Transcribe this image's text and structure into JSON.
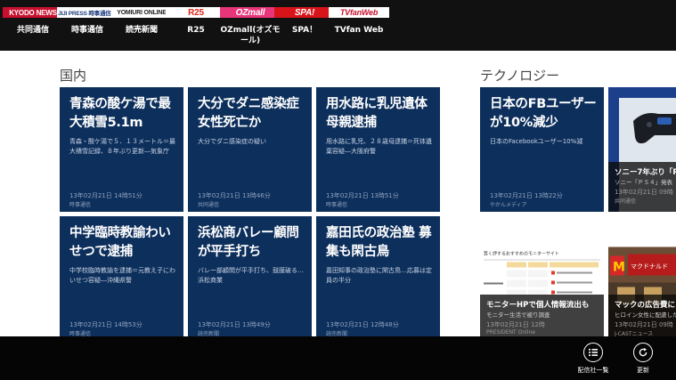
{
  "publishers": [
    {
      "logo": "KYODO NEWS",
      "name": "共同通信",
      "logo_bg": "#c8102e",
      "logo_fg": "#ffffff"
    },
    {
      "logo": "JIJI PRESS 時事通信社",
      "name": "時事通信",
      "logo_bg": "#ffffff",
      "logo_fg": "#1a3a7a"
    },
    {
      "logo": "YOMIURI ONLINE",
      "name": "読売新聞",
      "logo_bg": "#ffffff",
      "logo_fg": "#222222"
    },
    {
      "logo": "R25",
      "name": "R25",
      "logo_bg": "#ffffff",
      "logo_fg": "#e2231a"
    },
    {
      "logo": "OZmall",
      "name": "OZmall(オズモール)",
      "logo_bg": "#e8357a",
      "logo_fg": "#ffffff"
    },
    {
      "logo": "SPA!",
      "name": "SPA！",
      "logo_bg": "#d7141a",
      "logo_fg": "#ffffff"
    },
    {
      "logo": "TVfanWeb",
      "name": "TVfan Web",
      "logo_bg": "#ffffff",
      "logo_fg": "#c8102e"
    }
  ],
  "sections": {
    "domestic": {
      "title": "国内",
      "tiles": [
        {
          "headline": "青森の酸ケ湯で最大積雪5.1m",
          "summary": "青森・酸ケ湯で５．１３メートル＝最大積雪記録、８年ぶり更新―気象庁",
          "date": "13年02月21日 14時51分",
          "source": "時事通信"
        },
        {
          "headline": "大分でダニ感染症女性死亡か",
          "summary": "大分でダニ感染症の疑い",
          "date": "13年02月21日 13時46分",
          "source": "共同通信"
        },
        {
          "headline": "用水路に乳児遺体 母親逮捕",
          "summary": "用水路に乳児、２８歳母逮捕＝死体遺棄容疑―大阪府警",
          "date": "13年02月21日 13時51分",
          "source": "時事通信"
        },
        {
          "headline": "中学臨時教諭わいせつで逮捕",
          "summary": "中学校臨時教諭を逮捕＝元教え子にわいせつ容疑―沖縄県警",
          "date": "13年02月21日 14時53分",
          "source": "時事通信"
        },
        {
          "headline": "浜松商バレー顧問が平手打ち",
          "summary": "バレー部顧問が平手打ち、鼓膜破る…浜松商業",
          "date": "13年02月21日 13時49分",
          "source": "読売新聞"
        },
        {
          "headline": "嘉田氏の政治塾 募集も閑古鳥",
          "summary": "嘉田知事の政治塾に閑古鳥…応募は定員の半分",
          "date": "13年02月21日 12時48分",
          "source": "読売新聞"
        }
      ]
    },
    "technology": {
      "title": "テクノロジー",
      "tiles": [
        {
          "headline": "日本のFBユーザーが10%減少",
          "summary": "日本のFacebookユーザー10%減",
          "date": "13年02月21日 13時22分",
          "source": "やかんメディア"
        },
        {
          "headline": "ソニー7年ぶり「PS",
          "summary": "ソニー「ＰＳ４」発表",
          "date": "13年02月21日 09時",
          "source": "共同通信"
        },
        {
          "headline": "モニターHPで個人情報流出も",
          "summary": "モニター生活で被り調査",
          "date": "13年02月21日 12時",
          "source": "PRESIDENT Online"
        },
        {
          "headline": "マックの広告費に",
          "summary": "ヒロイン女性に配慮した",
          "date": "13年02月21日 09時",
          "source": "J-CASTニュース"
        }
      ],
      "figure_text": {
        "monitor_heading": "質く評するおすすめのモニターサイト",
        "mcd_sign": "マクドナルド"
      }
    }
  },
  "appbar": {
    "publisher_list_label": "配信社一覧",
    "refresh_label": "更新"
  },
  "colors": {
    "tile_bg": "#0d2f5c",
    "topbar_bg": "#111111",
    "appbar_bg": "#050505"
  }
}
